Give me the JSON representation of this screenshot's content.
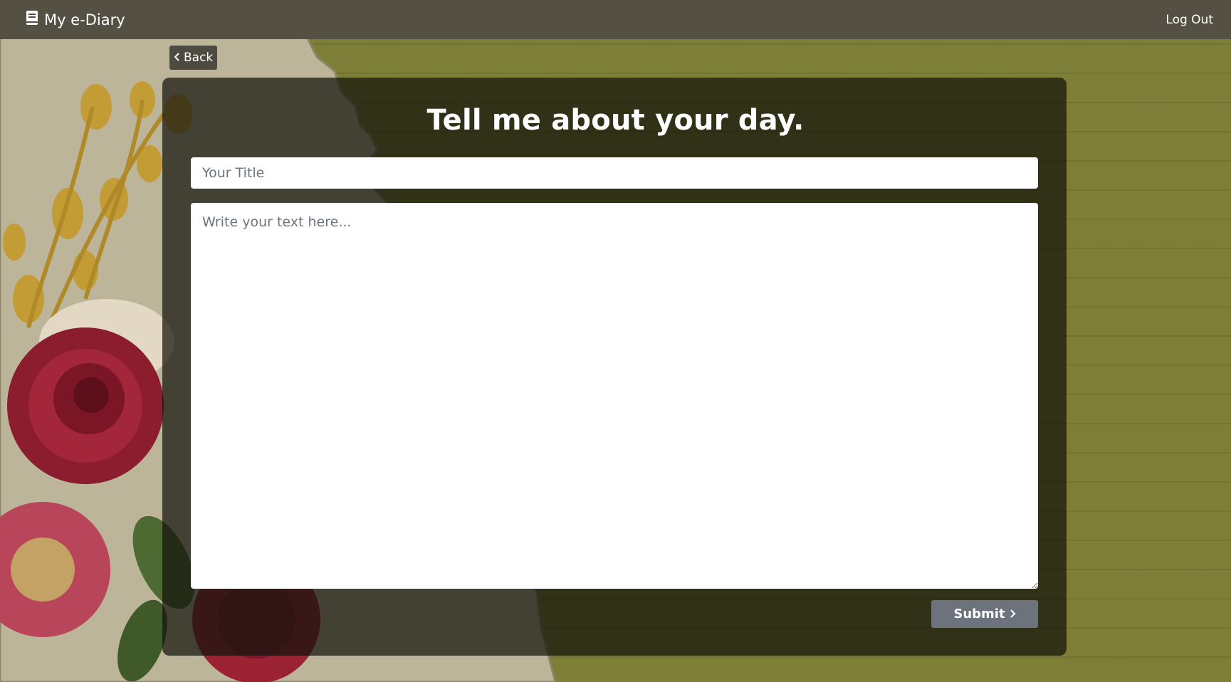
{
  "navbar": {
    "brand_icon": "book-icon",
    "brand_label": "My e-Diary",
    "logout_label": "Log Out"
  },
  "back_button": {
    "icon": "chevron-left-icon",
    "label": "Back"
  },
  "form": {
    "heading": "Tell me about your day.",
    "title_placeholder": "Your Title",
    "title_value": "",
    "text_placeholder": "Write your text here...",
    "text_value": "",
    "submit_label": "Submit",
    "submit_icon": "chevron-right-icon"
  },
  "colors": {
    "navbar_bg": "#545044",
    "panel_bg": "#14140c",
    "submit_bg": "#6c737d",
    "background_green": "#7d7f38"
  }
}
